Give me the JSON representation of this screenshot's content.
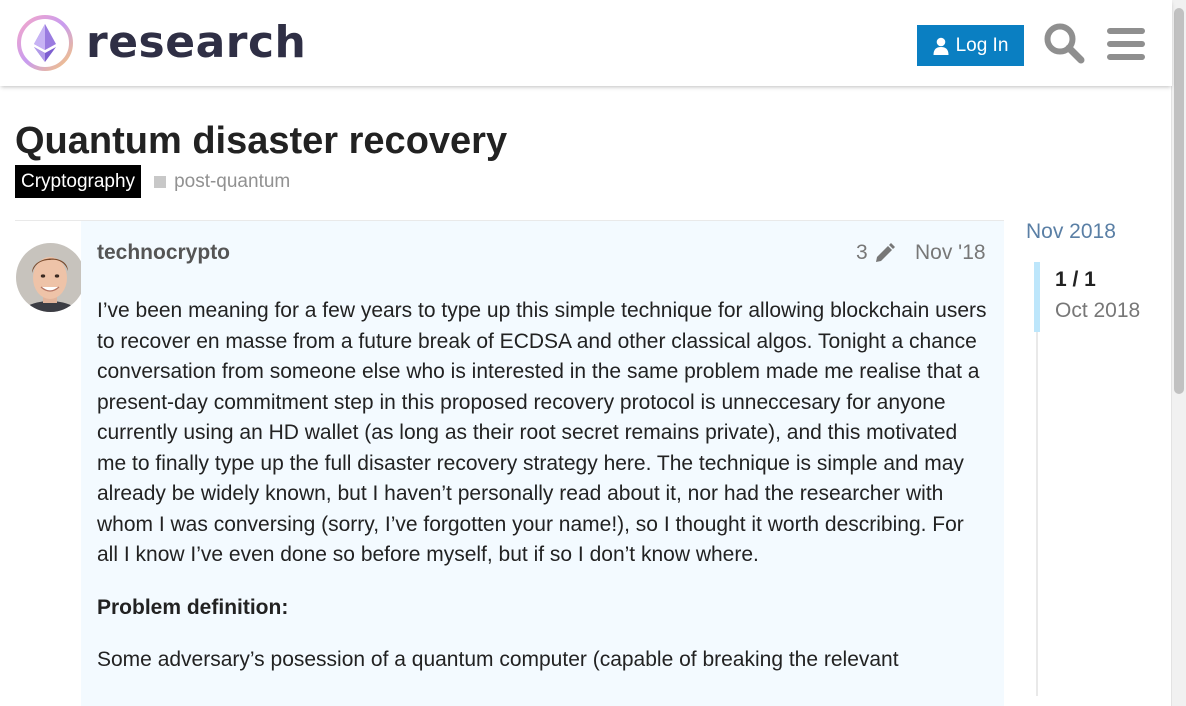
{
  "header": {
    "logo_text": "research",
    "login_label": "Log In",
    "icons": {
      "login": "user-icon",
      "search": "search-icon",
      "menu": "hamburger-menu-icon"
    },
    "colors": {
      "accent": "#0a7fc2",
      "logo_text": "#2f2f45"
    }
  },
  "topic": {
    "title": "Quantum disaster recovery",
    "category": "Cryptography",
    "tag": "post-quantum"
  },
  "post": {
    "author": "technocrypto",
    "edit_count": "3",
    "date": "Nov '18",
    "paragraphs": [
      "I’ve been meaning for a few years to type up this simple technique for allowing blockchain users to recover en masse from a future break of ECDSA and other classical algos. Tonight a chance conversation from someone else who is interested in the same problem made me realise that a present-day commitment step in this proposed recovery protocol is unneccesary for anyone currently using an HD wallet (as long as their root secret remains private), and this motivated me to finally type up the full disaster recovery strategy here. The technique is simple and may already be widely known, but I haven’t personally read about it, nor had the researcher with whom I was conversing (sorry, I’ve forgotten your name!), so I thought it worth describing. For all I know I’ve even done so before myself, but if so I don’t know where.",
      "Problem definition:",
      "Some adversary’s posession of a quantum computer (capable of breaking the relevant"
    ]
  },
  "timeline": {
    "top_date": "Nov 2018",
    "progress": "1 / 1",
    "current_date": "Oct 2018"
  }
}
